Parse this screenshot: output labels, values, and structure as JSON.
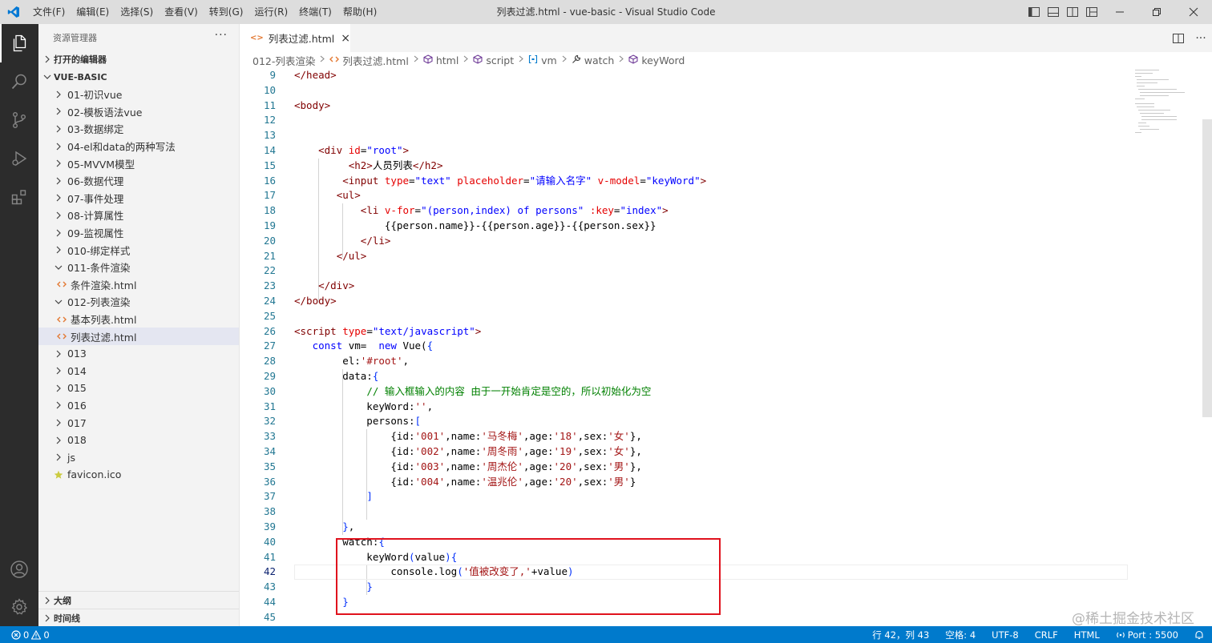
{
  "window": {
    "title": "列表过滤.html - vue-basic - Visual Studio Code",
    "menu": [
      "文件(F)",
      "编辑(E)",
      "选择(S)",
      "查看(V)",
      "转到(G)",
      "运行(R)",
      "终端(T)",
      "帮助(H)"
    ]
  },
  "activity_bar": {
    "items": [
      "explorer-icon",
      "search-icon",
      "source-control-icon",
      "run-debug-icon",
      "extensions-icon"
    ],
    "bottom_items": [
      "accounts-icon",
      "manage-gear-icon"
    ]
  },
  "sidebar": {
    "header": "资源管理器",
    "more": "···",
    "open_editors": "打开的编辑器",
    "root": "VUE-BASIC",
    "items": [
      {
        "label": "01-初识vue",
        "type": "folder",
        "expanded": false,
        "indent": 0
      },
      {
        "label": "02-模板语法vue",
        "type": "folder",
        "expanded": false,
        "indent": 0
      },
      {
        "label": "03-数据绑定",
        "type": "folder",
        "expanded": false,
        "indent": 0
      },
      {
        "label": "04-el和data的两种写法",
        "type": "folder",
        "expanded": false,
        "indent": 0
      },
      {
        "label": "05-MVVM模型",
        "type": "folder",
        "expanded": false,
        "indent": 0
      },
      {
        "label": "06-数据代理",
        "type": "folder",
        "expanded": false,
        "indent": 0
      },
      {
        "label": "07-事件处理",
        "type": "folder",
        "expanded": false,
        "indent": 0
      },
      {
        "label": "08-计算属性",
        "type": "folder",
        "expanded": false,
        "indent": 0
      },
      {
        "label": "09-监视属性",
        "type": "folder",
        "expanded": false,
        "indent": 0
      },
      {
        "label": "010-绑定样式",
        "type": "folder",
        "expanded": false,
        "indent": 0
      },
      {
        "label": "011-条件渲染",
        "type": "folder",
        "expanded": true,
        "indent": 0
      },
      {
        "label": "条件渲染.html",
        "type": "html",
        "indent": 1
      },
      {
        "label": "012-列表渲染",
        "type": "folder",
        "expanded": true,
        "indent": 0
      },
      {
        "label": "基本列表.html",
        "type": "html",
        "indent": 1
      },
      {
        "label": "列表过滤.html",
        "type": "html",
        "indent": 1,
        "selected": true
      },
      {
        "label": "013",
        "type": "folder",
        "expanded": false,
        "indent": 0
      },
      {
        "label": "014",
        "type": "folder",
        "expanded": false,
        "indent": 0
      },
      {
        "label": "015",
        "type": "folder",
        "expanded": false,
        "indent": 0
      },
      {
        "label": "016",
        "type": "folder",
        "expanded": false,
        "indent": 0
      },
      {
        "label": "017",
        "type": "folder",
        "expanded": false,
        "indent": 0
      },
      {
        "label": "018",
        "type": "folder",
        "expanded": false,
        "indent": 0
      },
      {
        "label": "js",
        "type": "folder",
        "expanded": false,
        "indent": 0
      },
      {
        "label": "favicon.ico",
        "type": "star",
        "indent": 0
      }
    ],
    "outline": "大纲",
    "timeline": "时间线"
  },
  "tab": {
    "label": "列表过滤.html",
    "file_icon": "<>",
    "close": "×"
  },
  "breadcrumb": [
    {
      "label": "012-列表渲染",
      "icon": ""
    },
    {
      "label": "列表过滤.html",
      "icon": "<>"
    },
    {
      "label": "html",
      "icon": "cube"
    },
    {
      "label": "script",
      "icon": "cube"
    },
    {
      "label": "vm",
      "icon": "[ ]"
    },
    {
      "label": "watch",
      "icon": "wrench"
    },
    {
      "label": "keyWord",
      "icon": "cube"
    }
  ],
  "editor": {
    "current_line": 42,
    "lines": [
      {
        "n": 9,
        "tokens": [
          [
            "t-tag",
            "</head>"
          ]
        ]
      },
      {
        "n": 10,
        "tokens": []
      },
      {
        "n": 11,
        "tokens": [
          [
            "t-tag",
            "<body>"
          ]
        ]
      },
      {
        "n": 12,
        "tokens": []
      },
      {
        "n": 13,
        "tokens": []
      },
      {
        "n": 14,
        "tokens": [
          [
            "t-def",
            "    "
          ],
          [
            "t-tag",
            "<div"
          ],
          [
            "t-def",
            " "
          ],
          [
            "t-attr",
            "id"
          ],
          [
            "t-def",
            "="
          ],
          [
            "t-str",
            "\"root\""
          ],
          [
            "t-tag",
            ">"
          ]
        ]
      },
      {
        "n": 15,
        "tokens": [
          [
            "t-def",
            "         "
          ],
          [
            "t-tag",
            "<h2>"
          ],
          [
            "t-def",
            "人员列表"
          ],
          [
            "t-tag",
            "</h2>"
          ]
        ]
      },
      {
        "n": 16,
        "tokens": [
          [
            "t-def",
            "        "
          ],
          [
            "t-tag",
            "<input"
          ],
          [
            "t-def",
            " "
          ],
          [
            "t-attr",
            "type"
          ],
          [
            "t-def",
            "="
          ],
          [
            "t-str",
            "\"text\""
          ],
          [
            "t-def",
            " "
          ],
          [
            "t-attr",
            "placeholder"
          ],
          [
            "t-def",
            "="
          ],
          [
            "t-str",
            "\"请输入名字\""
          ],
          [
            "t-def",
            " "
          ],
          [
            "t-attr",
            "v-model"
          ],
          [
            "t-def",
            "="
          ],
          [
            "t-str",
            "\"keyWord\""
          ],
          [
            "t-tag",
            ">"
          ]
        ]
      },
      {
        "n": 17,
        "tokens": [
          [
            "t-def",
            "       "
          ],
          [
            "t-tag",
            "<ul>"
          ]
        ]
      },
      {
        "n": 18,
        "tokens": [
          [
            "t-def",
            "           "
          ],
          [
            "t-tag",
            "<li"
          ],
          [
            "t-def",
            " "
          ],
          [
            "t-attr",
            "v-for"
          ],
          [
            "t-def",
            "="
          ],
          [
            "t-str",
            "\"(person,index) of persons\""
          ],
          [
            "t-def",
            " "
          ],
          [
            "t-attr",
            ":key"
          ],
          [
            "t-def",
            "="
          ],
          [
            "t-str",
            "\"index\""
          ],
          [
            "t-tag",
            ">"
          ]
        ]
      },
      {
        "n": 19,
        "tokens": [
          [
            "t-def",
            "               {{person.name}}-{{person.age}}-{{person.sex}}"
          ]
        ]
      },
      {
        "n": 20,
        "tokens": [
          [
            "t-def",
            "           "
          ],
          [
            "t-tag",
            "</li>"
          ]
        ]
      },
      {
        "n": 21,
        "tokens": [
          [
            "t-def",
            "       "
          ],
          [
            "t-tag",
            "</ul>"
          ]
        ]
      },
      {
        "n": 22,
        "tokens": []
      },
      {
        "n": 23,
        "tokens": [
          [
            "t-def",
            "    "
          ],
          [
            "t-tag",
            "</div>"
          ]
        ]
      },
      {
        "n": 24,
        "tokens": [
          [
            "t-tag",
            "</body>"
          ]
        ]
      },
      {
        "n": 25,
        "tokens": []
      },
      {
        "n": 26,
        "tokens": [
          [
            "t-tag",
            "<script"
          ],
          [
            "t-def",
            " "
          ],
          [
            "t-attr",
            "type"
          ],
          [
            "t-def",
            "="
          ],
          [
            "t-str",
            "\"text/javascript\""
          ],
          [
            "t-tag",
            ">"
          ]
        ]
      },
      {
        "n": 27,
        "tokens": [
          [
            "t-def",
            "   "
          ],
          [
            "t-kw",
            "const"
          ],
          [
            "t-def",
            " vm=  "
          ],
          [
            "t-kw",
            "new"
          ],
          [
            "t-def",
            " Vue("
          ],
          [
            "t-br",
            "{"
          ]
        ]
      },
      {
        "n": 28,
        "tokens": [
          [
            "t-def",
            "        el:"
          ],
          [
            "t-strj",
            "'#root'"
          ],
          [
            "t-def",
            ","
          ]
        ]
      },
      {
        "n": 29,
        "tokens": [
          [
            "t-def",
            "        data:"
          ],
          [
            "t-br",
            "{"
          ]
        ]
      },
      {
        "n": 30,
        "tokens": [
          [
            "t-def",
            "            "
          ],
          [
            "t-com",
            "// 输入框输入的内容 由于一开始肯定是空的，所以初始化为空"
          ]
        ]
      },
      {
        "n": 31,
        "tokens": [
          [
            "t-def",
            "            keyWord:"
          ],
          [
            "t-strj",
            "''"
          ],
          [
            "t-def",
            ","
          ]
        ]
      },
      {
        "n": 32,
        "tokens": [
          [
            "t-def",
            "            persons:"
          ],
          [
            "t-br",
            "["
          ]
        ]
      },
      {
        "n": 33,
        "tokens": [
          [
            "t-def",
            "                {id:"
          ],
          [
            "t-strj",
            "'001'"
          ],
          [
            "t-def",
            ",name:"
          ],
          [
            "t-strj",
            "'马冬梅'"
          ],
          [
            "t-def",
            ",age:"
          ],
          [
            "t-strj",
            "'18'"
          ],
          [
            "t-def",
            ",sex:"
          ],
          [
            "t-strj",
            "'女'"
          ],
          [
            "t-def",
            "},"
          ]
        ]
      },
      {
        "n": 34,
        "tokens": [
          [
            "t-def",
            "                {id:"
          ],
          [
            "t-strj",
            "'002'"
          ],
          [
            "t-def",
            ",name:"
          ],
          [
            "t-strj",
            "'周冬雨'"
          ],
          [
            "t-def",
            ",age:"
          ],
          [
            "t-strj",
            "'19'"
          ],
          [
            "t-def",
            ",sex:"
          ],
          [
            "t-strj",
            "'女'"
          ],
          [
            "t-def",
            "},"
          ]
        ]
      },
      {
        "n": 35,
        "tokens": [
          [
            "t-def",
            "                {id:"
          ],
          [
            "t-strj",
            "'003'"
          ],
          [
            "t-def",
            ",name:"
          ],
          [
            "t-strj",
            "'周杰伦'"
          ],
          [
            "t-def",
            ",age:"
          ],
          [
            "t-strj",
            "'20'"
          ],
          [
            "t-def",
            ",sex:"
          ],
          [
            "t-strj",
            "'男'"
          ],
          [
            "t-def",
            "},"
          ]
        ]
      },
      {
        "n": 36,
        "tokens": [
          [
            "t-def",
            "                {id:"
          ],
          [
            "t-strj",
            "'004'"
          ],
          [
            "t-def",
            ",name:"
          ],
          [
            "t-strj",
            "'温兆伦'"
          ],
          [
            "t-def",
            ",age:"
          ],
          [
            "t-strj",
            "'20'"
          ],
          [
            "t-def",
            ",sex:"
          ],
          [
            "t-strj",
            "'男'"
          ],
          [
            "t-def",
            "}"
          ]
        ]
      },
      {
        "n": 37,
        "tokens": [
          [
            "t-def",
            "            "
          ],
          [
            "t-br",
            "]"
          ]
        ]
      },
      {
        "n": 38,
        "tokens": []
      },
      {
        "n": 39,
        "tokens": [
          [
            "t-def",
            "        "
          ],
          [
            "t-br",
            "}"
          ],
          [
            "t-def",
            ","
          ]
        ]
      },
      {
        "n": 40,
        "tokens": [
          [
            "t-def",
            "        watch:"
          ],
          [
            "t-br",
            "{"
          ]
        ]
      },
      {
        "n": 41,
        "tokens": [
          [
            "t-def",
            "            keyWord"
          ],
          [
            "t-br",
            "("
          ],
          [
            "t-def",
            "value"
          ],
          [
            "t-br",
            ")"
          ],
          [
            "t-br",
            "{"
          ]
        ]
      },
      {
        "n": 42,
        "tokens": [
          [
            "t-def",
            "                console.log"
          ],
          [
            "t-br",
            "("
          ],
          [
            "t-strj",
            "'值被改变了,'"
          ],
          [
            "t-def",
            "+value"
          ],
          [
            "t-br",
            ")"
          ]
        ]
      },
      {
        "n": 43,
        "tokens": [
          [
            "t-def",
            "            "
          ],
          [
            "t-br",
            "}"
          ]
        ]
      },
      {
        "n": 44,
        "tokens": [
          [
            "t-def",
            "        "
          ],
          [
            "t-br",
            "}"
          ]
        ]
      },
      {
        "n": 45,
        "tokens": []
      }
    ]
  },
  "status_bar": {
    "errors": "0",
    "warnings": "0",
    "position": "行 42，列 43",
    "spaces": "空格: 4",
    "encoding": "UTF-8",
    "eol": "CRLF",
    "language": "HTML",
    "port": "Port : 5500"
  },
  "watermark": "@稀土掘金技术社区",
  "colors": {
    "accent": "#007acc",
    "highlight_box": "#e0121d"
  }
}
